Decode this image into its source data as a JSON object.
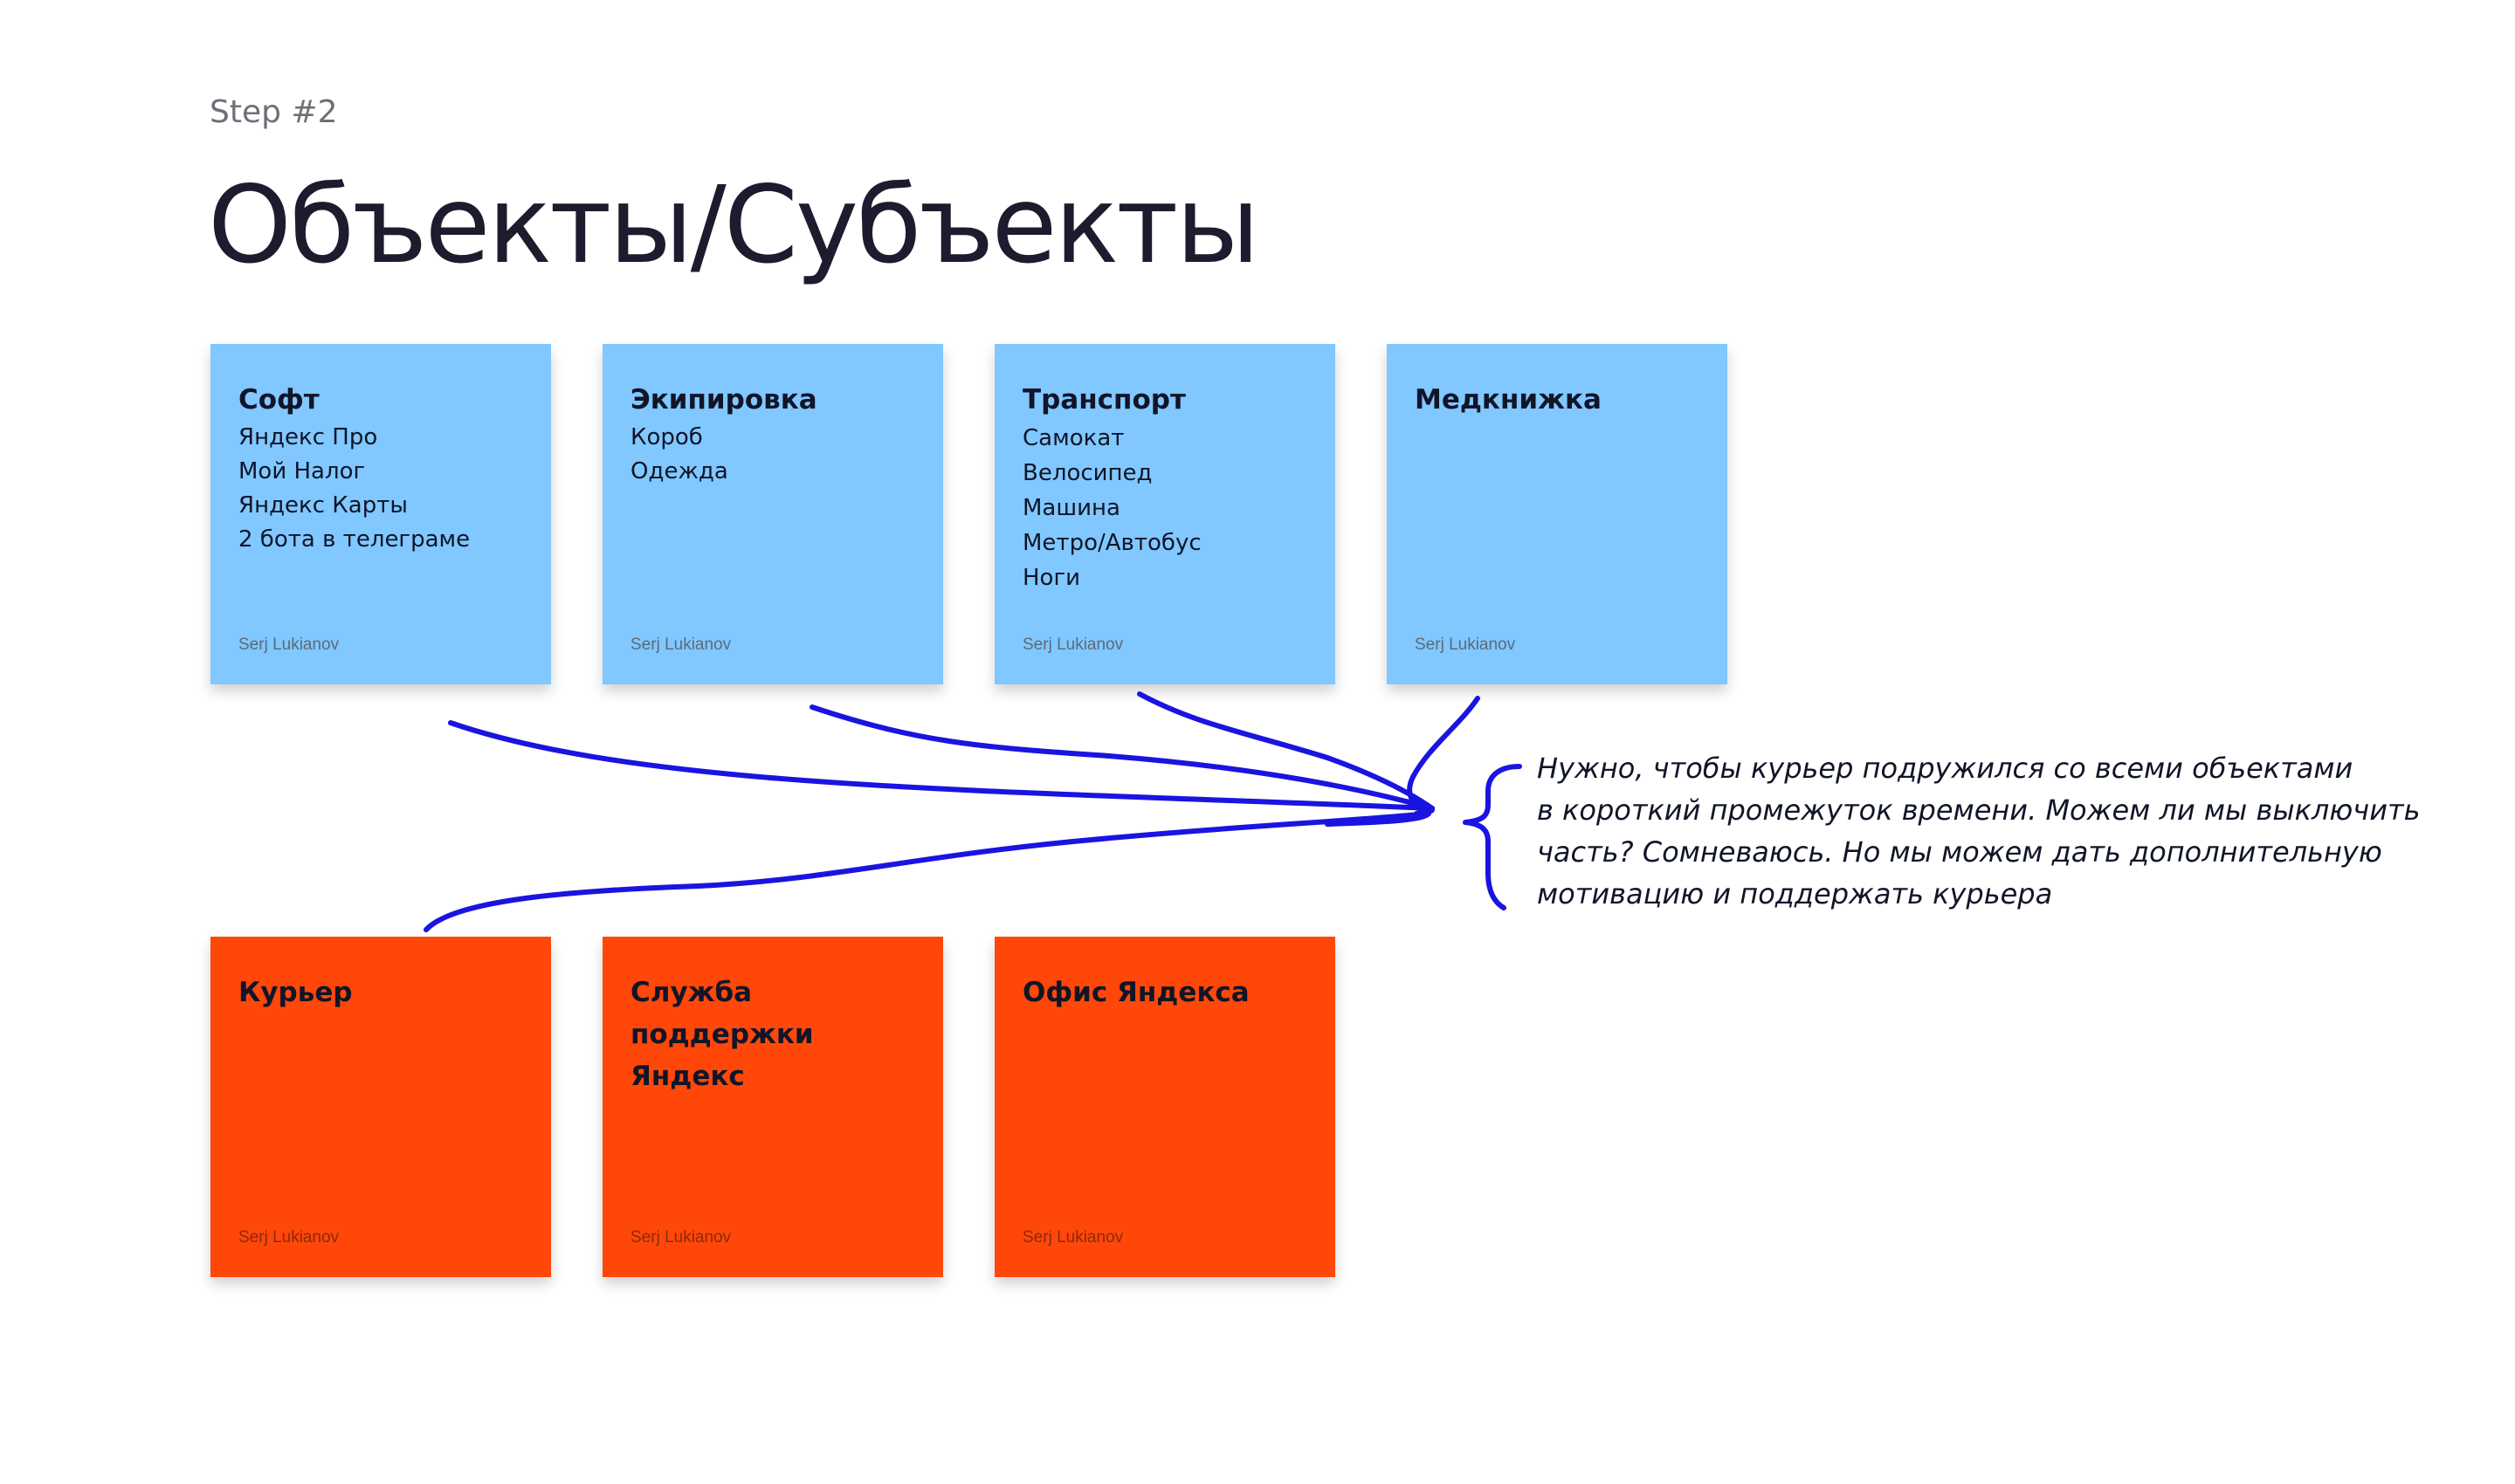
{
  "header": {
    "step": "Step #2",
    "title": "Объекты/Субъекты"
  },
  "objects": [
    {
      "title": "Софт",
      "items": [
        "Яндекс Про",
        "Мой Налог",
        "Яндекс Карты",
        "2 бота в телеграме"
      ],
      "author": "Serj Lukianov"
    },
    {
      "title": "Экипировка",
      "items": [
        "Короб",
        "Одежда"
      ],
      "author": "Serj Lukianov"
    },
    {
      "title": "Транспорт",
      "items": [
        "Самокат",
        "Велосипед",
        "Машина",
        "Метро/Автобус",
        "Ноги"
      ],
      "author": "Serj Lukianov"
    },
    {
      "title": "Медкнижка",
      "items": [],
      "author": "Serj Lukianov"
    }
  ],
  "subjects": [
    {
      "title": "Курьер",
      "author": "Serj Lukianov"
    },
    {
      "title": "Служба поддержки Яндекс",
      "author": "Serj Lukianov"
    },
    {
      "title": "Офис Яндекса",
      "author": "Serj Lukianov"
    }
  ],
  "annotation": {
    "text": "Нужно, чтобы курьер подружился со всеми объектами\nв короткий промежуток времени. Можем ли мы выключить\nчасть? Сомневаюсь. Но мы можем дать дополнительную\nмотивацию и поддержать курьера"
  },
  "colors": {
    "object_note": "#80c8ff",
    "subject_note": "#ff4709",
    "ink": "#1a14e0",
    "title_text": "#1c1c2e"
  }
}
